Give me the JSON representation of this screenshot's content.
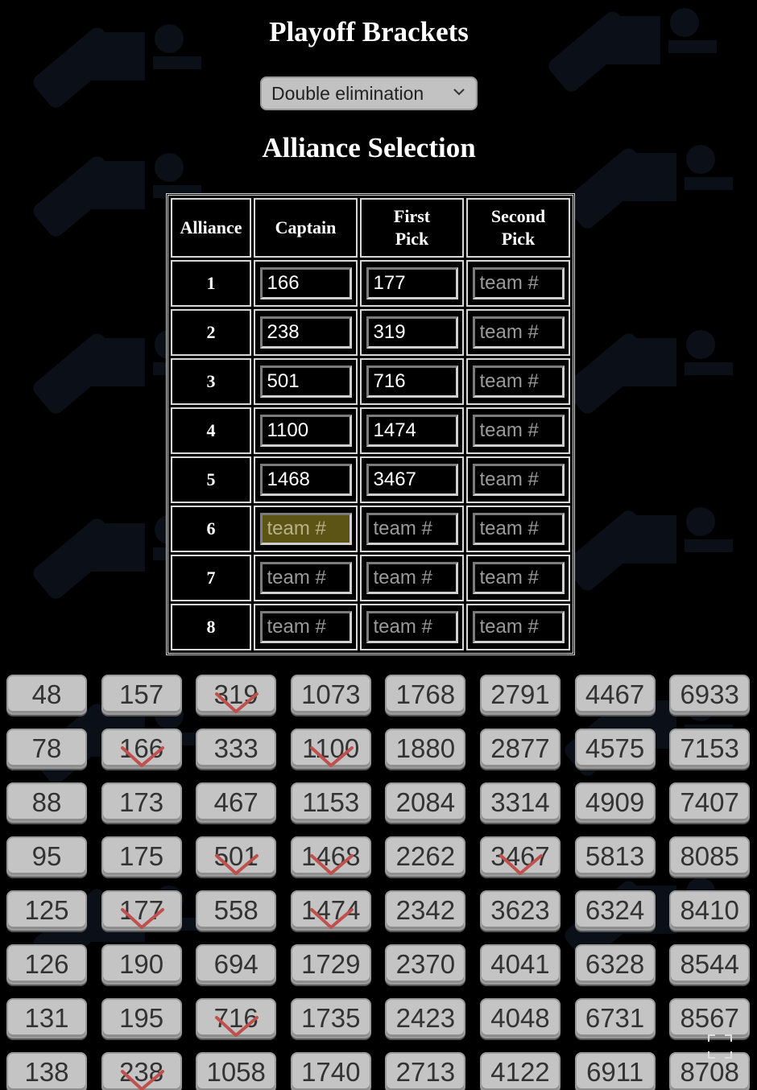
{
  "page": {
    "title": "Playoff Brackets",
    "section_title": "Alliance Selection"
  },
  "format_select": {
    "selected": "Double elimination"
  },
  "table": {
    "headers": [
      "Alliance",
      "Captain",
      "First Pick",
      "Second Pick"
    ],
    "placeholder": "team #",
    "rows": [
      {
        "alliance": "1",
        "captain": "166",
        "first": "177",
        "second": ""
      },
      {
        "alliance": "2",
        "captain": "238",
        "first": "319",
        "second": ""
      },
      {
        "alliance": "3",
        "captain": "501",
        "first": "716",
        "second": ""
      },
      {
        "alliance": "4",
        "captain": "1100",
        "first": "1474",
        "second": ""
      },
      {
        "alliance": "5",
        "captain": "1468",
        "first": "3467",
        "second": ""
      },
      {
        "alliance": "6",
        "captain": "",
        "first": "",
        "second": ""
      },
      {
        "alliance": "7",
        "captain": "",
        "first": "",
        "second": ""
      },
      {
        "alliance": "8",
        "captain": "",
        "first": "",
        "second": ""
      }
    ],
    "focused_cell": "row6-captain"
  },
  "teams": {
    "columns": [
      [
        "48",
        "78",
        "88",
        "95",
        "125",
        "126",
        "131",
        "138"
      ],
      [
        "157",
        "166",
        "173",
        "175",
        "177",
        "190",
        "195",
        "238"
      ],
      [
        "319",
        "333",
        "467",
        "501",
        "558",
        "694",
        "716",
        "1058"
      ],
      [
        "1073",
        "1100",
        "1153",
        "1468",
        "1474",
        "1729",
        "1735",
        "1740"
      ],
      [
        "1768",
        "1880",
        "2084",
        "2262",
        "2342",
        "2370",
        "2423",
        "2713"
      ],
      [
        "2791",
        "2877",
        "3314",
        "3467",
        "3623",
        "4041",
        "4048",
        "4122"
      ],
      [
        "4467",
        "4575",
        "4909",
        "5813",
        "6324",
        "6328",
        "6731",
        "6911"
      ],
      [
        "6933",
        "7153",
        "7407",
        "8085",
        "8410",
        "8544",
        "8567",
        "8708"
      ]
    ],
    "selected": [
      "166",
      "177",
      "238",
      "319",
      "501",
      "716",
      "1100",
      "1474",
      "1468",
      "3467"
    ],
    "check_color": "#c0504d"
  },
  "icons": {
    "select_chevron": "chevron-down-icon",
    "fullscreen": "fullscreen-icon"
  }
}
